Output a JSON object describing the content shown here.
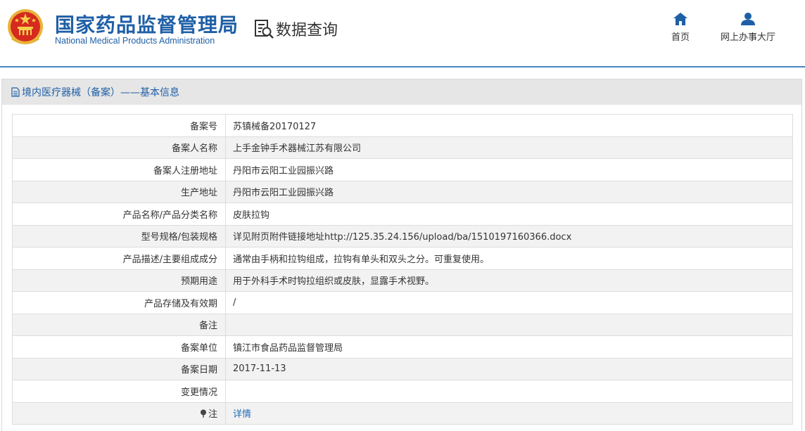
{
  "header": {
    "brand_cn": "国家药品监督管理局",
    "brand_en": "National Medical Products Administration",
    "query_label": "数据查询",
    "nav": [
      {
        "label": "首页",
        "icon": "home-icon"
      },
      {
        "label": "网上办事大厅",
        "icon": "user-icon"
      }
    ]
  },
  "colors": {
    "brand": "#1f5fa6",
    "accent_line": "#4a86c5",
    "link": "#1f6cb5"
  },
  "panel": {
    "title": "境内医疗器械（备案）——基本信息",
    "title_icon": "document-icon",
    "rows": [
      {
        "label": "备案号",
        "value": "苏镇械备20170127"
      },
      {
        "label": "备案人名称",
        "value": "上手金钟手术器械江苏有限公司"
      },
      {
        "label": "备案人注册地址",
        "value": "丹阳市云阳工业园振兴路"
      },
      {
        "label": "生产地址",
        "value": "丹阳市云阳工业园振兴路"
      },
      {
        "label": "产品名称/产品分类名称",
        "value": "皮肤拉钩"
      },
      {
        "label": "型号规格/包装规格",
        "value": "详见附页附件链接地址http://125.35.24.156/upload/ba/1510197160366.docx"
      },
      {
        "label": "产品描述/主要组成成分",
        "value": "通常由手柄和拉钩组成，拉钩有单头和双头之分。可重复使用。"
      },
      {
        "label": "预期用途",
        "value": "用于外科手术时钩拉组织或皮肤，显露手术视野。"
      },
      {
        "label": "产品存储及有效期",
        "value": "/"
      },
      {
        "label": "备注",
        "value": ""
      },
      {
        "label": "备案单位",
        "value": "镇江市食品药品监督管理局"
      },
      {
        "label": "备案日期",
        "value": "2017-11-13"
      },
      {
        "label": "变更情况",
        "value": ""
      }
    ],
    "note": {
      "label": "注",
      "icon": "pin-icon",
      "link": "详情"
    }
  }
}
